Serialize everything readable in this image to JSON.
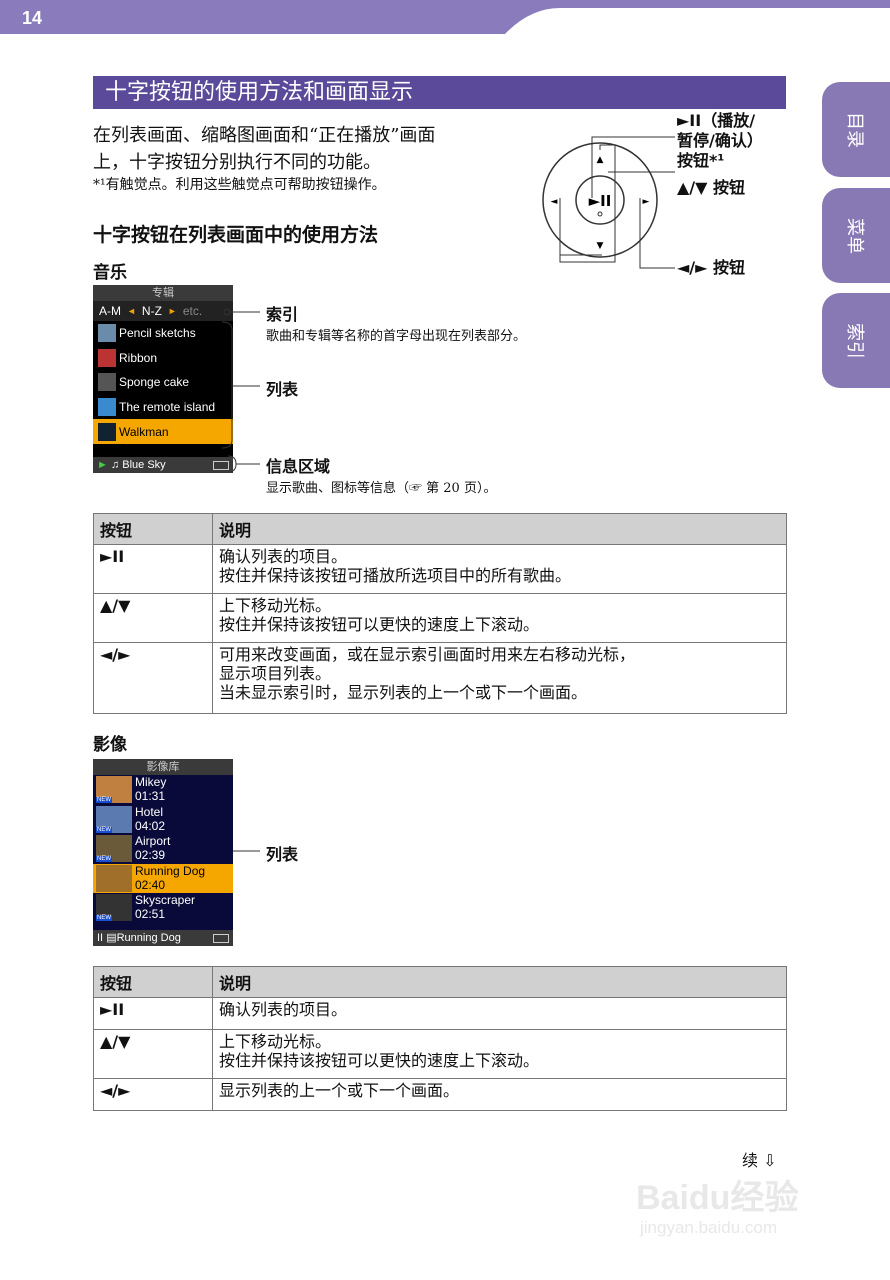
{
  "page_number": "14",
  "section_title": "十字按钮的使用方法和画面显示",
  "side_tabs": [
    "目录",
    "菜单",
    "索引"
  ],
  "intro": {
    "line1": "在列表画面、缩略图画面和“正在播放”画面",
    "line2": "上，十字按钮分别执行不同的功能。",
    "note": "*¹有触觉点。利用这些触觉点可帮助按钮操作。"
  },
  "dial_labels": {
    "play": "►II（播放/",
    "play2": "暂停/确认）",
    "play3": "按钮*¹",
    "updown": "▲/▼ 按钮",
    "leftright": "◄/► 按钮"
  },
  "list_heading": "十字按钮在列表画面中的使用方法",
  "music": {
    "heading": "音乐",
    "screen_title": "专辑",
    "index": [
      "A-M",
      "N-Z",
      "etc."
    ],
    "items": [
      "Pencil sketchs",
      "Ribbon",
      "Sponge cake",
      "The remote island",
      "Walkman"
    ],
    "status": "Blue Sky",
    "callouts": {
      "index_title": "索引",
      "index_desc": "歌曲和专辑等名称的首字母出现在列表部分。",
      "list_title": "列表",
      "info_title": "信息区域",
      "info_desc": "显示歌曲、图标等信息（☞ 第 20 页）。"
    }
  },
  "table1": {
    "headers": [
      "按钮",
      "说明"
    ],
    "rows": [
      {
        "key": "►II",
        "l1": "确认列表的项目。",
        "l2": "按住并保持该按钮可播放所选项目中的所有歌曲。",
        "l3": ""
      },
      {
        "key": "▲/▼",
        "l1": "上下移动光标。",
        "l2": "按住并保持该按钮可以更快的速度上下滚动。",
        "l3": ""
      },
      {
        "key": "◄/►",
        "l1": "可用来改变画面，或在显示索引画面时用来左右移动光标，",
        "l2": "显示项目列表。",
        "l3": "当未显示索引时，显示列表的上一个或下一个画面。"
      }
    ]
  },
  "video": {
    "heading": "影像",
    "screen_title": "影像库",
    "items": [
      {
        "name": "Mikey",
        "time": "01:31"
      },
      {
        "name": "Hotel",
        "time": "04:02"
      },
      {
        "name": "Airport",
        "time": "02:39"
      },
      {
        "name": "Running Dog",
        "time": "02:40"
      },
      {
        "name": "Skyscraper",
        "time": "02:51"
      }
    ],
    "new_badge": "NEW",
    "status": "Running Dog",
    "list_callout": "列表"
  },
  "table2": {
    "headers": [
      "按钮",
      "说明"
    ],
    "rows": [
      {
        "key": "►II",
        "l1": "确认列表的项目。",
        "l2": ""
      },
      {
        "key": "▲/▼",
        "l1": "上下移动光标。",
        "l2": "按住并保持该按钮可以更快的速度上下滚动。"
      },
      {
        "key": "◄/►",
        "l1": "显示列表的上一个或下一个画面。",
        "l2": ""
      }
    ]
  },
  "continued": "续 ⇩",
  "watermark": {
    "main": "Baidu经验",
    "url": "jingyan.baidu.com"
  },
  "colors": {
    "accent": "#5b4a9a",
    "tab": "#8878b4",
    "highlight": "#f5a700"
  }
}
